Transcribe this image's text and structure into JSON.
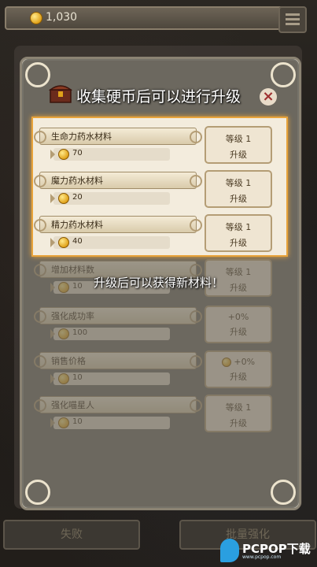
{
  "topbar": {
    "coins": "1,030"
  },
  "dialog": {
    "title": "收集硬币后可以进行升级",
    "close_label": "×",
    "hint": "升级后可以获得新材料！"
  },
  "upgrades": [
    {
      "name": "生命力药水材料",
      "cost": "70",
      "level": "等级 1",
      "action": "升级",
      "highlighted": true
    },
    {
      "name": "魔力药水材料",
      "cost": "20",
      "level": "等级 1",
      "action": "升级",
      "highlighted": true
    },
    {
      "name": "精力药水材料",
      "cost": "40",
      "level": "等级 1",
      "action": "升级",
      "highlighted": true
    },
    {
      "name": "增加材料数",
      "cost": "10",
      "level": "等级 1",
      "action": "升级",
      "highlighted": false
    },
    {
      "name": "强化成功率",
      "cost": "100",
      "level": "+0%",
      "action": "升级",
      "highlighted": false
    },
    {
      "name": "销售价格",
      "cost": "10",
      "level": "+0%",
      "action": "升级",
      "highlighted": false
    },
    {
      "name": "强化喵星人",
      "cost": "10",
      "level": "等级 1",
      "action": "升级",
      "highlighted": false
    }
  ],
  "bottom": {
    "left_label": "失败",
    "right_label": "批量强化"
  },
  "watermark": {
    "text": "PCPOP下载",
    "sub": "www.pcpop.com"
  },
  "colors": {
    "accent": "#e8a33a",
    "coin": "#e0a21a",
    "panel": "#d7d0c0"
  }
}
